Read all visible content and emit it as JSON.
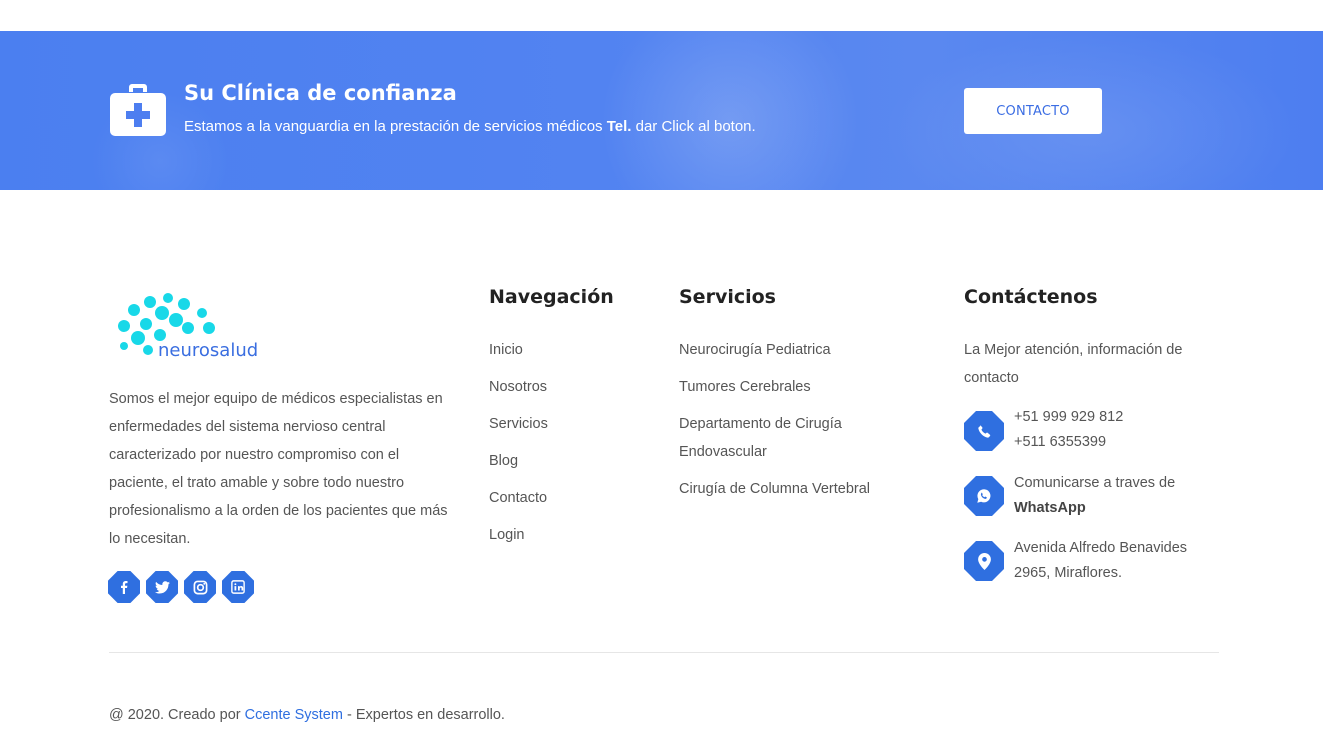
{
  "colors": {
    "accent": "#2f6fe0",
    "banner": "#4d7ef0",
    "heading": "#222222",
    "text": "#555555"
  },
  "cta": {
    "icon": "first-aid-kit-icon",
    "title": "Su Clínica de confianza",
    "subtitle_pre": "Estamos a la vanguardia en la prestación de servicios médicos ",
    "subtitle_bold": "Tel.",
    "subtitle_post": " dar Click al boton.",
    "button": "CONTACTO"
  },
  "brand": {
    "logo_text": "neurosalud",
    "about": "Somos el mejor equipo de médicos especialistas en enfermedades del sistema nervioso central caracterizado por nuestro compromiso con el paciente, el trato amable y sobre todo nuestro profesionalismo a la orden de los pacientes que más lo necesitan.",
    "social": [
      "facebook-icon",
      "twitter-icon",
      "instagram-icon",
      "linkedin-icon"
    ]
  },
  "navigation": {
    "title": "Navegación",
    "items": [
      "Inicio",
      "Nosotros",
      "Servicios",
      "Blog",
      "Contacto",
      "Login"
    ]
  },
  "services": {
    "title": "Servicios",
    "items": [
      "Neurocirugía Pediatrica",
      "Tumores Cerebrales",
      "Departamento de Cirugía Endovascular",
      "Cirugía de Columna Vertebral"
    ]
  },
  "contact": {
    "title": "Contáctenos",
    "intro": "La Mejor atención, información de contacto",
    "phone1": "+51 999 929 812",
    "phone2": "+511 6355399",
    "whatsapp_pre": "Comunicarse a traves de",
    "whatsapp_bold": "WhatsApp",
    "address1": "Avenida Alfredo Benavides",
    "address2": "2965, Miraflores."
  },
  "footer": {
    "copy_pre": "@ 2020. Creado por ",
    "copy_link": "Ccente System",
    "copy_post": " - Expertos en desarrollo."
  }
}
